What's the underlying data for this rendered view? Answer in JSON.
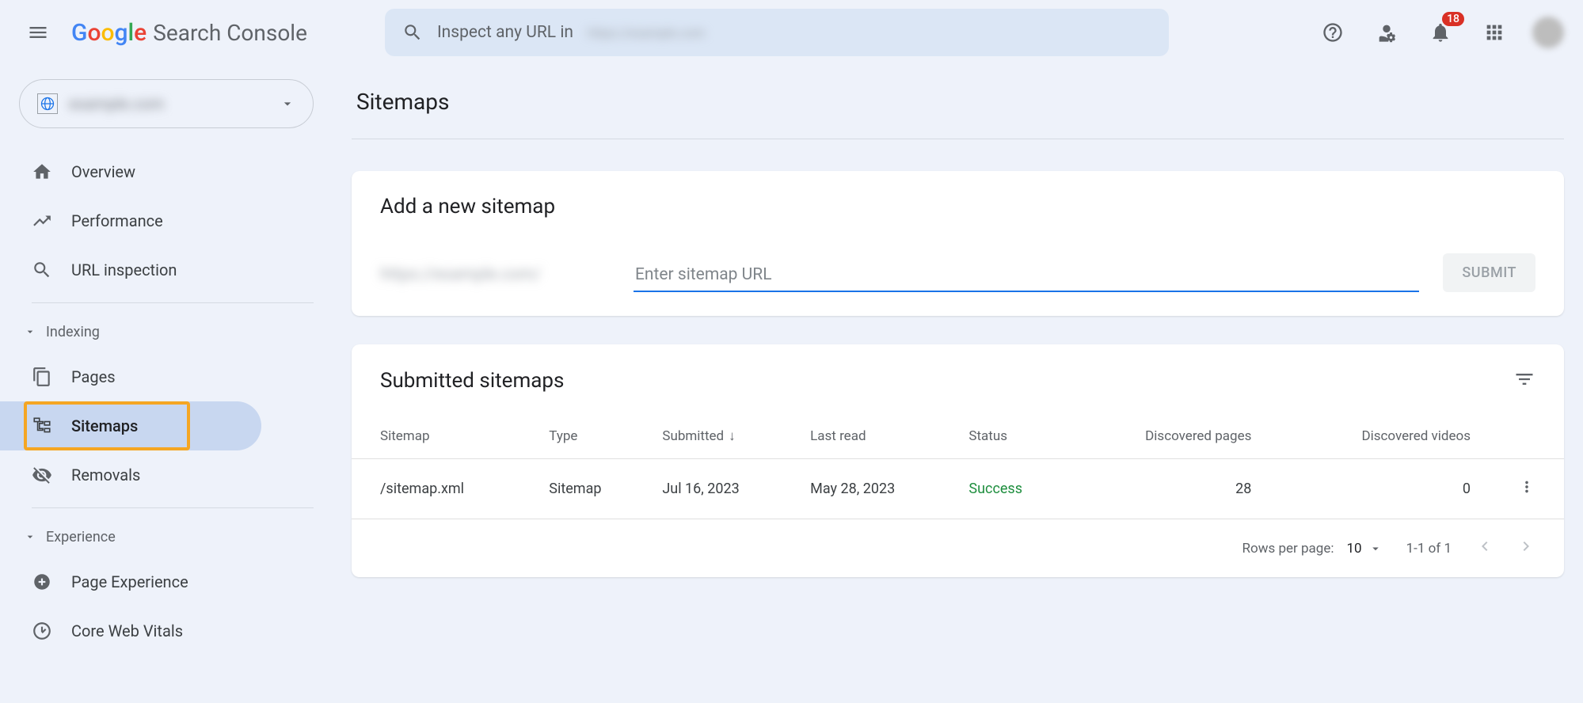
{
  "header": {
    "product_name": "Search Console",
    "search_prefix": "Inspect any URL in",
    "notifications_count": "18"
  },
  "sidebar": {
    "items": {
      "overview": "Overview",
      "performance": "Performance",
      "url_inspection": "URL inspection",
      "pages": "Pages",
      "sitemaps": "Sitemaps",
      "removals": "Removals",
      "page_experience": "Page Experience",
      "core_web_vitals": "Core Web Vitals"
    },
    "sections": {
      "indexing": "Indexing",
      "experience": "Experience"
    }
  },
  "page": {
    "title": "Sitemaps",
    "add_card": {
      "title": "Add a new sitemap",
      "placeholder": "Enter sitemap URL",
      "submit": "SUBMIT"
    },
    "table": {
      "title": "Submitted sitemaps",
      "columns": {
        "sitemap": "Sitemap",
        "type": "Type",
        "submitted": "Submitted",
        "last_read": "Last read",
        "status": "Status",
        "discovered_pages": "Discovered pages",
        "discovered_videos": "Discovered videos"
      },
      "rows": [
        {
          "sitemap": "/sitemap.xml",
          "type": "Sitemap",
          "submitted": "Jul 16, 2023",
          "last_read": "May 28, 2023",
          "status": "Success",
          "discovered_pages": "28",
          "discovered_videos": "0"
        }
      ],
      "pagination": {
        "rows_label": "Rows per page:",
        "page_size": "10",
        "range": "1-1 of 1"
      }
    }
  }
}
